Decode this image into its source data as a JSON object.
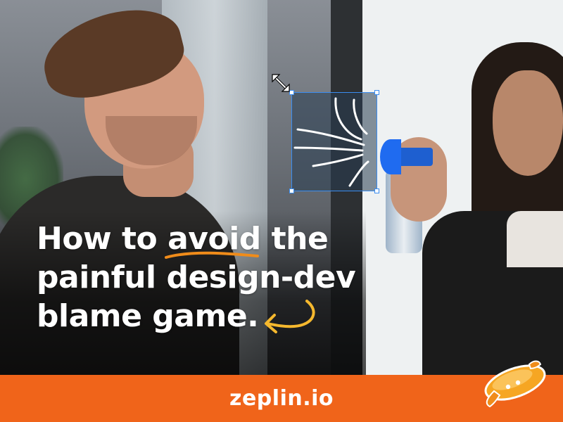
{
  "headline": {
    "line1_before": "How to ",
    "line1_emph": "avoid",
    "line1_after": " the",
    "line2": "painful design-dev",
    "line3": "blame game."
  },
  "footer": {
    "text": "zeplin.io"
  },
  "icons": {
    "resize_cursor": "diagonal-resize-cursor-icon",
    "brand_mark": "zeplin-zeppelin-logo-icon"
  },
  "colors": {
    "accent_orange": "#f0641a",
    "underline_orange": "#f08c1a",
    "arrow_yellow": "#f5b82e",
    "selection_blue": "#3b8df0",
    "text_white": "#ffffff"
  }
}
